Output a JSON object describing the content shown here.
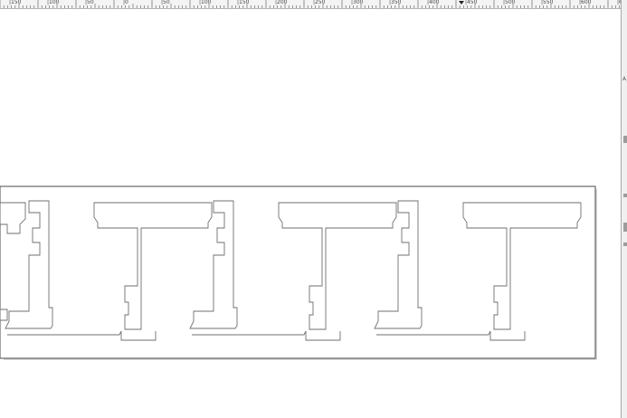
{
  "ruler": {
    "labels": [
      "|150",
      "|100",
      "|50",
      "|0",
      "|50",
      "|100",
      "|150",
      "|200",
      "|250",
      "|300",
      "|350",
      "|400",
      "|450",
      "|500",
      "|550",
      "|600",
      "|650"
    ]
  },
  "side_panel": {
    "glyphs": [
      "A",
      "a"
    ]
  },
  "colors": {
    "outline": "#6f6f6f",
    "shadow": "#4a4a4a",
    "ruler_bg": "#f4f4f4",
    "panel_bg": "#f0f0f0"
  }
}
